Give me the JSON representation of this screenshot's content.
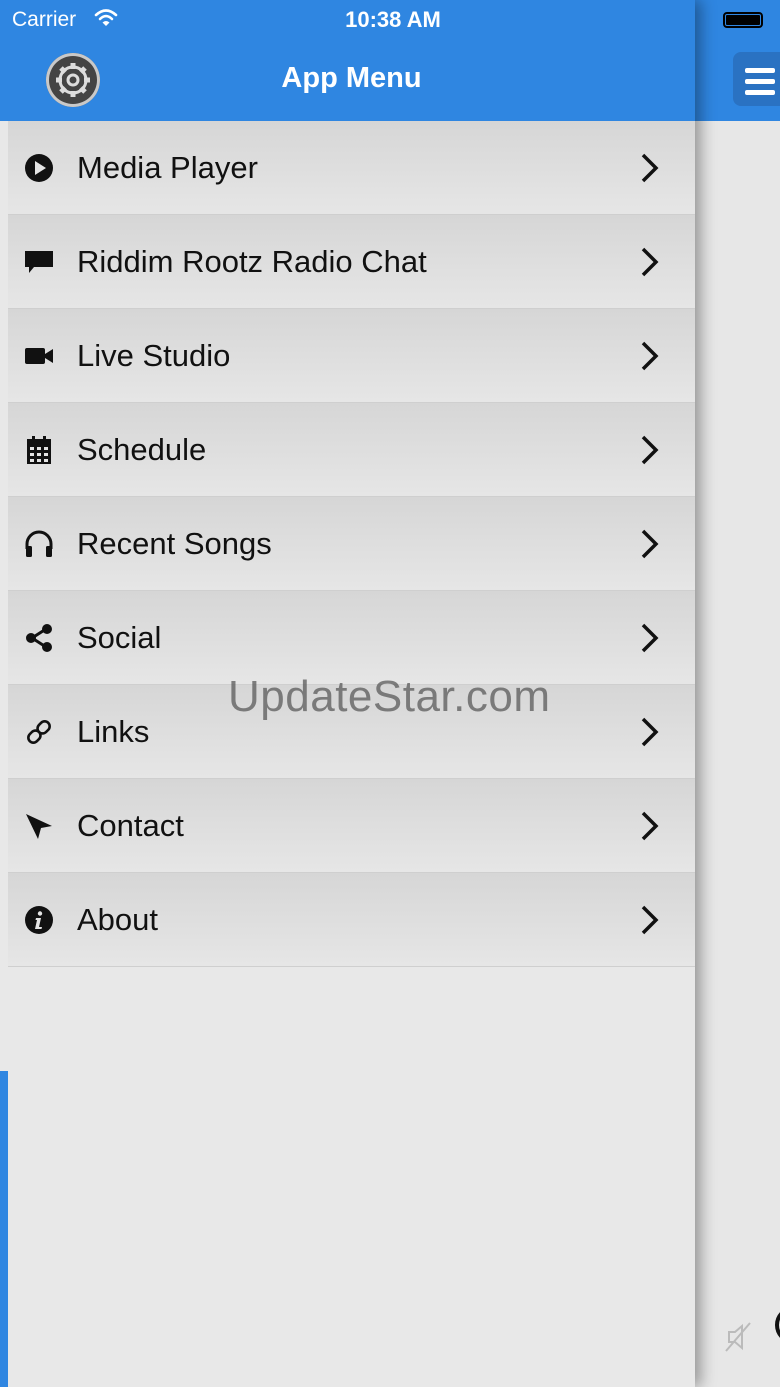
{
  "status_bar": {
    "carrier": "Carrier",
    "time": "10:38 AM"
  },
  "drawer": {
    "title": "App Menu",
    "settings_icon": "gear-icon",
    "items": [
      {
        "label": "Media Player",
        "icon": "play-circle-icon"
      },
      {
        "label": "Riddim Rootz Radio Chat",
        "icon": "chat-bubble-icon"
      },
      {
        "label": "Live Studio",
        "icon": "video-camera-icon"
      },
      {
        "label": "Schedule",
        "icon": "calendar-icon"
      },
      {
        "label": "Recent Songs",
        "icon": "headphones-icon"
      },
      {
        "label": "Social",
        "icon": "share-icon"
      },
      {
        "label": "Links",
        "icon": "link-icon"
      },
      {
        "label": "Contact",
        "icon": "paper-plane-icon"
      },
      {
        "label": "About",
        "icon": "info-circle-icon"
      }
    ]
  },
  "content": {
    "menu_button_icon": "hamburger-icon",
    "bottom_icon": "mute-icon"
  },
  "watermark": "UpdateStar.com",
  "colors": {
    "header_blue": "#2f86e1",
    "menu_bg": "#e6e6e6",
    "text": "#111111"
  }
}
